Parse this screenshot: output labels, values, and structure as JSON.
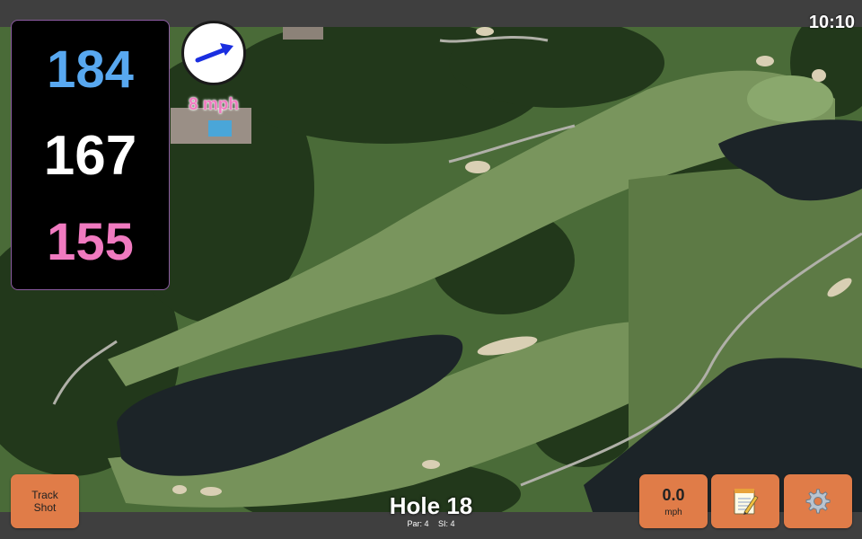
{
  "status": {
    "time": "10:10"
  },
  "distances": {
    "back": "184",
    "middle": "167",
    "front": "155"
  },
  "wind": {
    "speed": "8 mph",
    "icon": "wind-direction-arrow-icon"
  },
  "buttons": {
    "track_shot_line1": "Track",
    "track_shot_line2": "Shot",
    "speed_value": "0.0",
    "speed_unit": "mph",
    "notes_icon": "notepad-icon",
    "settings_icon": "gear-icon"
  },
  "hole": {
    "title": "Hole 18",
    "par": "Par: 4",
    "si": "SI: 4"
  },
  "colors": {
    "back_distance": "#58a8f0",
    "middle_distance": "#ffffff",
    "front_distance": "#f07ac0",
    "button": "#e07c48",
    "bar": "#3f3f3f"
  }
}
